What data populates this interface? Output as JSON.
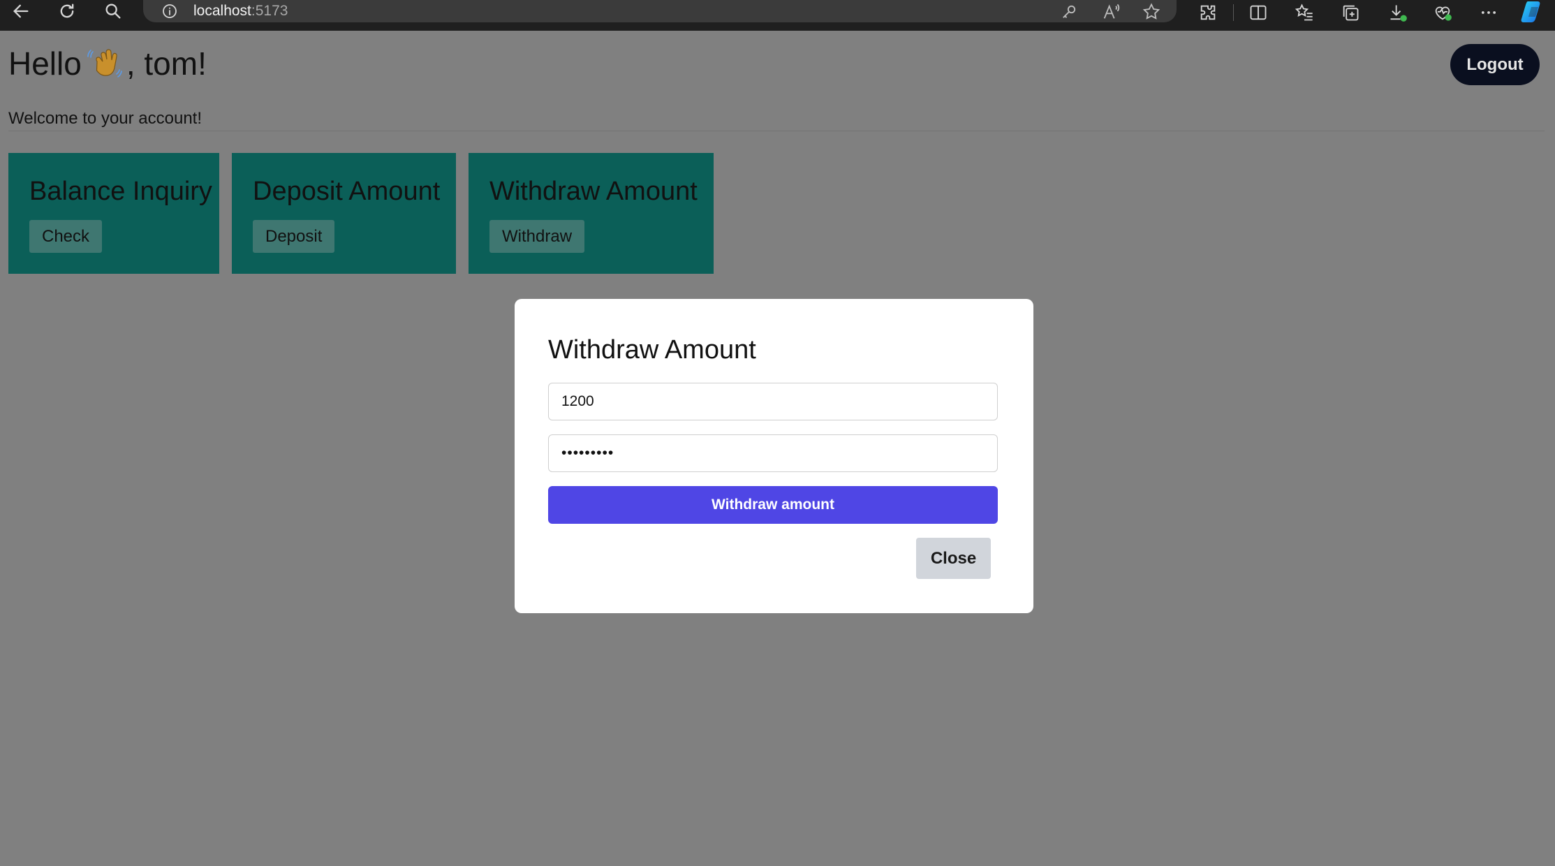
{
  "browser": {
    "url_host": "localhost",
    "url_port": ":5173",
    "icons": [
      "back-arrow-icon",
      "refresh-icon",
      "search-icon",
      "info-icon",
      "key-icon",
      "read-aloud-icon",
      "star-icon",
      "extensions-icon",
      "split-screen-icon",
      "favorites-icon",
      "collections-icon",
      "downloads-icon",
      "browser-essentials-icon",
      "more-options-icon",
      "copilot-icon"
    ]
  },
  "header": {
    "greeting_prefix": "Hello",
    "greeting_suffix": ", tom!",
    "wave_icon": "waving-hand-icon",
    "logout_label": "Logout"
  },
  "welcome_text": "Welcome to your account!",
  "cards": [
    {
      "title": "Balance Inquiry",
      "button": "Check"
    },
    {
      "title": "Deposit Amount",
      "button": "Deposit"
    },
    {
      "title": "Withdraw Amount",
      "button": "Withdraw"
    }
  ],
  "modal": {
    "title": "Withdraw Amount",
    "amount_value": "1200",
    "password_value": "•••••••••",
    "submit_label": "Withdraw amount",
    "close_label": "Close"
  },
  "colors": {
    "overlay": "#808080",
    "card": "#0b5f58",
    "card_button": "#3f7771",
    "primary": "#4f46e5",
    "logout": "#0a0f1f",
    "close_button": "#d1d5db"
  }
}
